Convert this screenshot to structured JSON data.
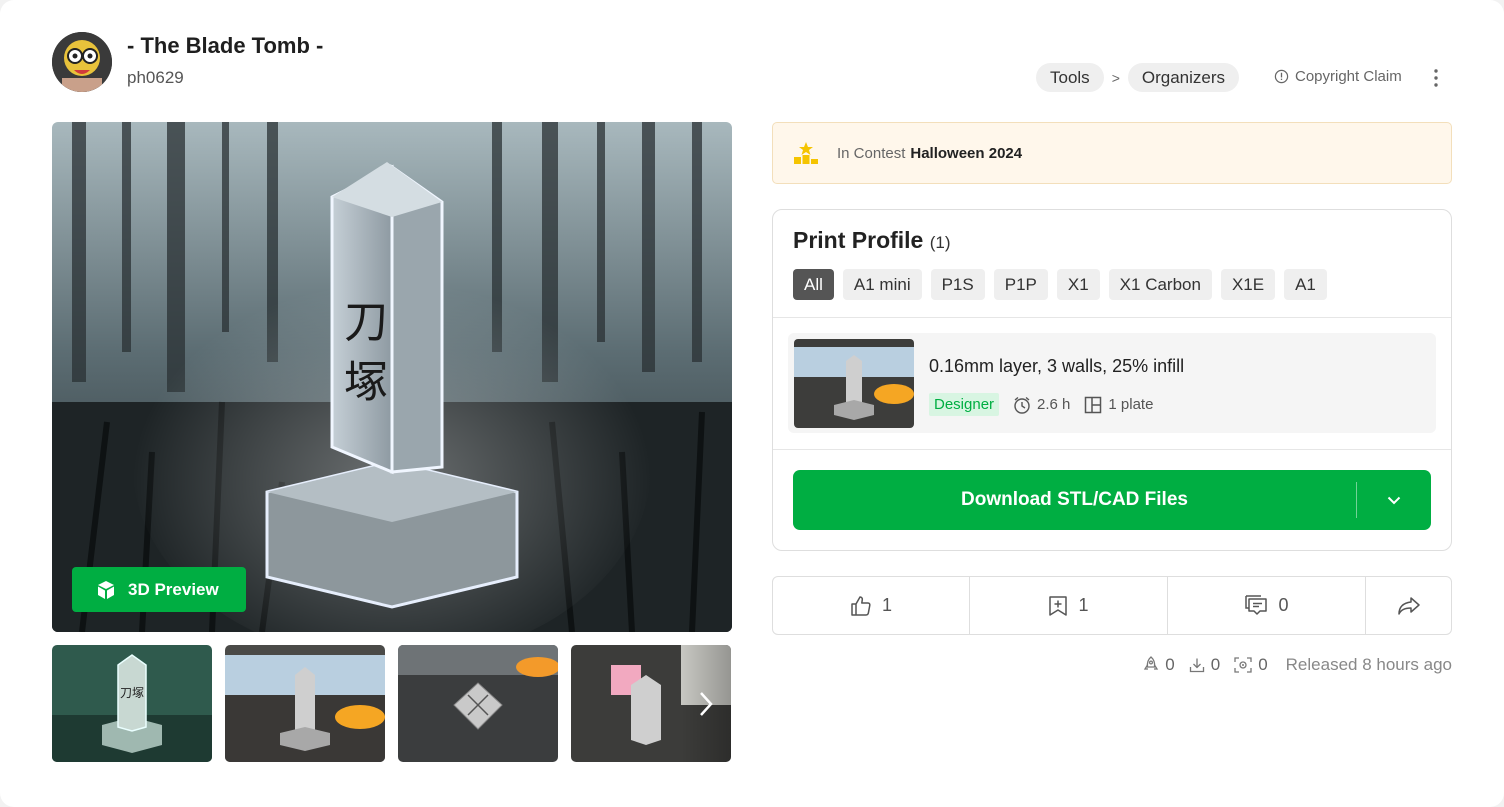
{
  "model": {
    "title": "- The Blade Tomb -",
    "author": "ph0629",
    "avatar_icon": "avatar"
  },
  "breadcrumb": {
    "items": [
      "Tools",
      "Organizers"
    ],
    "separator": ">"
  },
  "copyright_label": "Copyright Claim",
  "hero": {
    "kanji_top": "刀",
    "kanji_bottom": "塚",
    "preview_label": "3D Preview"
  },
  "thumbnails": {
    "kanji": "刀塚"
  },
  "contest": {
    "prefix": "In Contest",
    "name": "Halloween 2024"
  },
  "print_profile": {
    "title": "Print Profile",
    "count": "(1)",
    "filters": [
      "All",
      "A1 mini",
      "P1S",
      "P1P",
      "X1",
      "X1 Carbon",
      "X1E",
      "A1"
    ],
    "active_filter": "All",
    "item": {
      "name": "0.16mm layer, 3 walls, 25% infill",
      "badge": "Designer",
      "time": "2.6 h",
      "plates": "1 plate"
    },
    "download_label": "Download STL/CAD Files"
  },
  "actions": {
    "likes": "1",
    "collects": "1",
    "comments": "0"
  },
  "stats": {
    "boosts": "0",
    "downloads": "0",
    "prints": "0",
    "released": "Released 8 hours ago"
  },
  "colors": {
    "brand_green": "#00ae42",
    "contest_bg": "#fff7eb"
  }
}
